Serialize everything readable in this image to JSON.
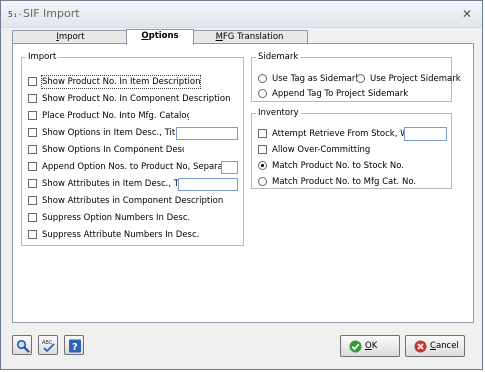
{
  "window": {
    "title": "SIF Import",
    "icon_text": "5₁·"
  },
  "tabs": [
    {
      "label": "Import",
      "mnemonic": "I",
      "rest": "mport"
    },
    {
      "label": "Options",
      "mnemonic": "O",
      "rest": "ptions"
    },
    {
      "label": "MFG Translation",
      "mnemonic": "M",
      "rest": "FG Translation"
    }
  ],
  "import_group": {
    "legend": "Import",
    "items": [
      {
        "label": "Show Product No. In Item Description",
        "checked": false
      },
      {
        "label": "Show Product No. In Component Description",
        "checked": false
      },
      {
        "label": "Place Product No. Into Mfg. Catalog No",
        "checked": false
      },
      {
        "label": "Show Options in Item Desc., Title:",
        "checked": false,
        "field_value": ""
      },
      {
        "label": "Show Options In Component Descriptic",
        "checked": false
      },
      {
        "label": "Append Option Nos. to Product No, Separator:",
        "checked": false,
        "field_value": ""
      },
      {
        "label": "Show Attributes in Item Desc., Title:",
        "checked": false,
        "field_value": ""
      },
      {
        "label": "Show Attributes in Component Description",
        "checked": false
      },
      {
        "label": "Suppress Option Numbers In Desc.",
        "checked": false
      },
      {
        "label": "Suppress Attribute Numbers In Desc.",
        "checked": false
      }
    ]
  },
  "sidemark_group": {
    "legend": "Sidemark",
    "options": [
      {
        "label": "Use Tag as Sidemark",
        "selected": false
      },
      {
        "label": "Use Project Sidemark",
        "selected": false
      },
      {
        "label": "Append Tag To Project Sidemark",
        "selected": false
      }
    ]
  },
  "inventory_group": {
    "legend": "Inventory",
    "attempt_retrieve": {
      "label": "Attempt Retrieve From Stock, WH:",
      "checked": false,
      "field_value": ""
    },
    "allow_over": {
      "label": "Allow Over-Committing",
      "checked": false
    },
    "match_options": [
      {
        "label": "Match Product No. to Stock No.",
        "selected": true
      },
      {
        "label": "Match Product No. to Mfg Cat. No.",
        "selected": false
      }
    ]
  },
  "buttons": {
    "ok": "OK",
    "ok_mnemonic": "O",
    "ok_rest": "K",
    "cancel": "Cancel",
    "cancel_mnemonic": "C",
    "cancel_rest": "ancel"
  },
  "colors": {
    "accent": "#2e62b5",
    "ok_green": "#2e8b2e",
    "cancel_red": "#c0322b"
  }
}
